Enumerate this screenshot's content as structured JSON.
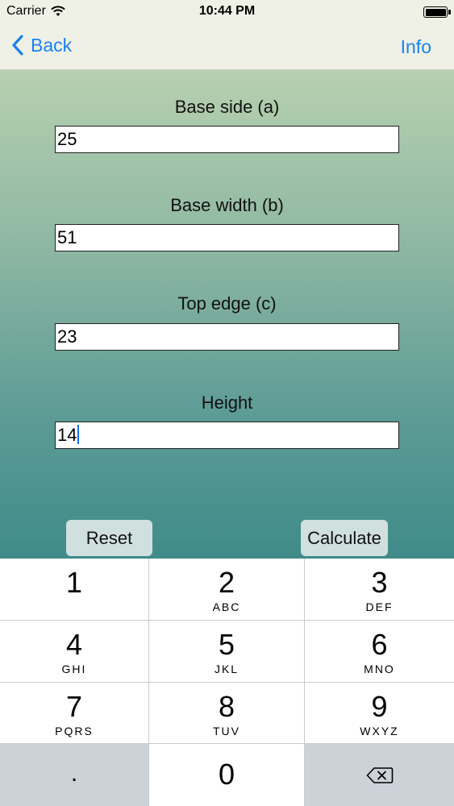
{
  "status_bar": {
    "carrier": "Carrier",
    "time": "10:44 PM"
  },
  "nav": {
    "back_label": "Back",
    "info_label": "Info"
  },
  "fields": [
    {
      "label": "Base side (a)",
      "value": "25"
    },
    {
      "label": "Base width (b)",
      "value": "51"
    },
    {
      "label": "Top edge (c)",
      "value": "23"
    },
    {
      "label": "Height",
      "value": "14"
    }
  ],
  "buttons": {
    "reset_label": "Reset",
    "calculate_label": "Calculate"
  },
  "keypad": {
    "keys": [
      {
        "num": "1",
        "letters": ""
      },
      {
        "num": "2",
        "letters": "ABC"
      },
      {
        "num": "3",
        "letters": "DEF"
      },
      {
        "num": "4",
        "letters": "GHI"
      },
      {
        "num": "5",
        "letters": "JKL"
      },
      {
        "num": "6",
        "letters": "MNO"
      },
      {
        "num": "7",
        "letters": "PQRS"
      },
      {
        "num": "8",
        "letters": "TUV"
      },
      {
        "num": "9",
        "letters": "WXYZ"
      },
      {
        "num": "0",
        "letters": ""
      }
    ],
    "decimal": ".",
    "delete_icon": "backspace-icon"
  },
  "colors": {
    "accent": "#1a82f0",
    "nav_bg": "#eff1e6",
    "gradient_top": "#b7d0b0",
    "gradient_bottom": "#3f8b89",
    "button_bg": "#cfe0de",
    "keypad_dark": "#cdd2d9"
  }
}
